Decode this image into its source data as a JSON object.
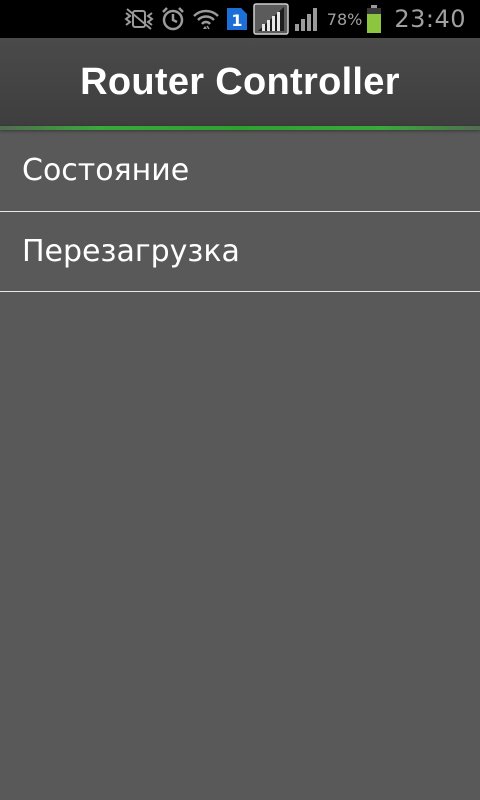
{
  "status_bar": {
    "icons": [
      "vibrate-muted-icon",
      "alarm-icon",
      "wifi-icon",
      "sim-1-icon",
      "signal-icon",
      "signal-icon",
      "battery-icon"
    ],
    "sim_label": "1",
    "battery_percent": "78%",
    "time": "23:40",
    "battery_color": "#8cc63f"
  },
  "action_bar": {
    "title": "Router Controller",
    "accent_color": "#2fa12f"
  },
  "menu": {
    "items": [
      {
        "label": "Состояние"
      },
      {
        "label": "Перезагрузка"
      }
    ]
  }
}
